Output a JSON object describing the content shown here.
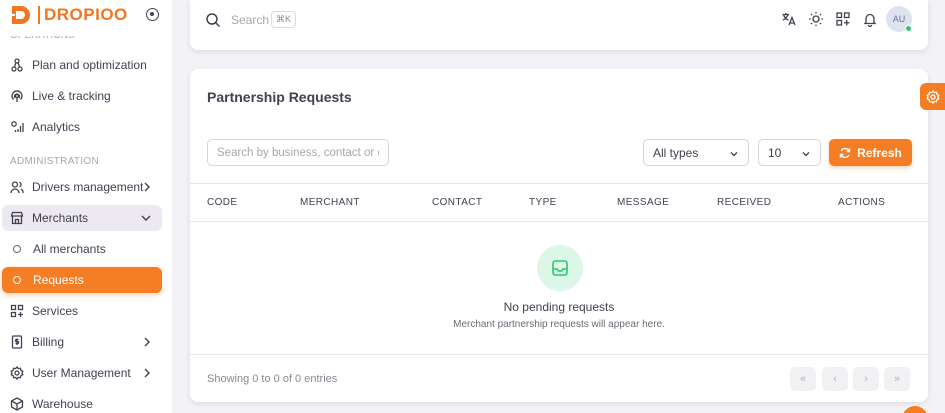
{
  "brand": {
    "name": "DROPIOO"
  },
  "colors": {
    "accent": "#f57e25",
    "success": "#28c76f"
  },
  "sidebar": {
    "top_items": [
      {
        "label": "Plan and optimization",
        "icon": "route-icon"
      },
      {
        "label": "Live & tracking",
        "icon": "live-signal-icon"
      },
      {
        "label": "Analytics",
        "icon": "analytics-icon"
      }
    ],
    "section_label": "ADMINISTRATION",
    "drivers": {
      "label": "Drivers management",
      "icon": "users-icon"
    },
    "merchants": {
      "label": "Merchants",
      "icon": "store-icon",
      "children": [
        {
          "label": "All merchants"
        },
        {
          "label": "Requests",
          "active": true
        }
      ]
    },
    "services": {
      "label": "Services",
      "icon": "apps-icon"
    },
    "billing": {
      "label": "Billing",
      "icon": "invoice-icon"
    },
    "user_management": {
      "label": "User Management",
      "icon": "settings-icon"
    },
    "warehouse": {
      "label": "Warehouse",
      "icon": "box-icon"
    }
  },
  "topbar": {
    "search_placeholder": "Search",
    "shortcut": "⌘K",
    "avatar_initials": "AU"
  },
  "card": {
    "title": "Partnership Requests",
    "search_placeholder": "Search by business, contact or email",
    "type_filter": "All types",
    "page_size": "10",
    "refresh_label": "Refresh",
    "columns": [
      "CODE",
      "MERCHANT",
      "CONTACT",
      "TYPE",
      "MESSAGE",
      "RECEIVED",
      "ACTIONS"
    ],
    "rows": [],
    "empty_title": "No pending requests",
    "empty_subtitle": "Merchant partnership requests will appear here.",
    "entries_text": "Showing 0 to 0 of 0 entries",
    "pagination": [
      "«",
      "‹",
      "›",
      "»"
    ]
  }
}
